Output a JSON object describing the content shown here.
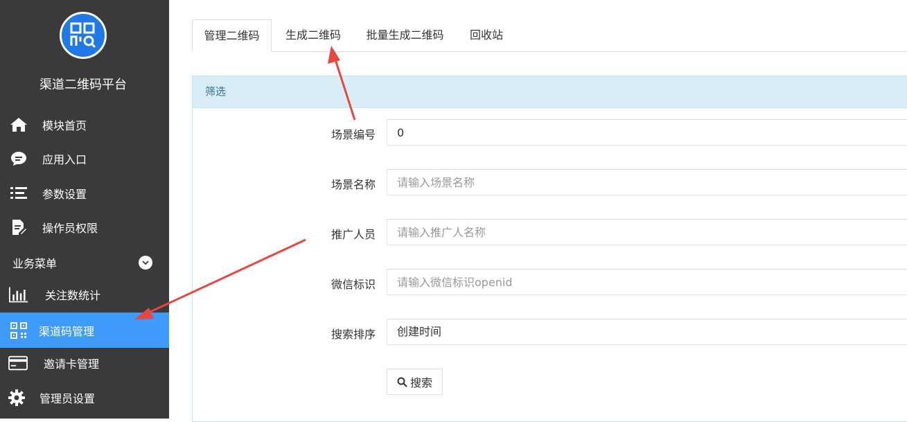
{
  "brand": {
    "title": "渠道二维码平台",
    "logo_icon": "qr-search-icon",
    "logo_color": "#1f79e6"
  },
  "sidebar": {
    "items": [
      {
        "label": "模块首页",
        "icon": "home-icon"
      },
      {
        "label": "应用入口",
        "icon": "chat-bubble-icon"
      },
      {
        "label": "参数设置",
        "icon": "list-icon"
      },
      {
        "label": "操作员权限",
        "icon": "document-edit-icon"
      }
    ],
    "section": {
      "label": "业务菜单",
      "icon": "chevron-down-icon"
    },
    "business_items": [
      {
        "label": "关注数统计",
        "icon": "bar-chart-icon"
      },
      {
        "label": "渠道码管理",
        "icon": "qr-code-icon",
        "active": true
      },
      {
        "label": "邀请卡管理",
        "icon": "card-icon"
      },
      {
        "label": "管理员设置",
        "icon": "gear-icon"
      }
    ],
    "active_color": "#3f9bfa",
    "background": "#3a3a3a"
  },
  "tabs": [
    {
      "label": "管理二维码",
      "active": true
    },
    {
      "label": "生成二维码"
    },
    {
      "label": "批量生成二维码"
    },
    {
      "label": "回收站"
    }
  ],
  "filter": {
    "title": "筛选",
    "fields": {
      "scene_id": {
        "label": "场景编号",
        "value": "0"
      },
      "scene_name": {
        "label": "场景名称",
        "placeholder": "请输入场景名称"
      },
      "promoter": {
        "label": "推广人员",
        "placeholder": "请输入推广人名称"
      },
      "openid": {
        "label": "微信标识",
        "placeholder": "请输入微信标识openid"
      },
      "sort": {
        "label": "搜索排序",
        "value": "创建时间"
      }
    },
    "search_button": "搜索"
  },
  "annotation_color": "#e8463e"
}
